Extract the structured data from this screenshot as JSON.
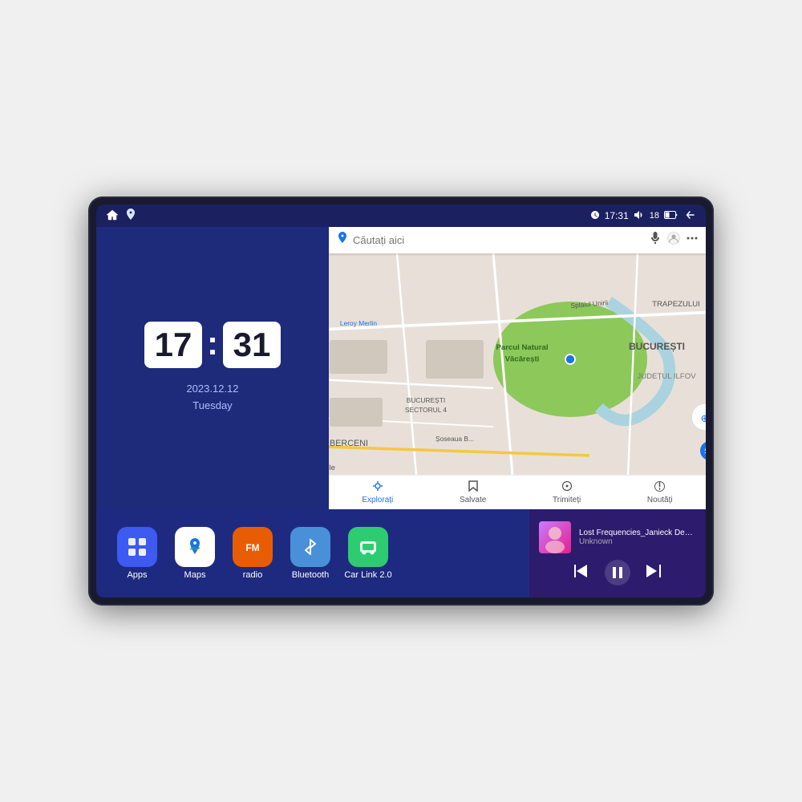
{
  "device": {
    "screen_bg": "#1a2060"
  },
  "status_bar": {
    "left_icons": [
      "home",
      "maps-pin"
    ],
    "time": "17:31",
    "battery": "18",
    "signal_icon": "wifi",
    "back_label": "↩"
  },
  "clock": {
    "hour": "17",
    "minute": "31",
    "date": "2023.12.12",
    "day": "Tuesday"
  },
  "map": {
    "search_placeholder": "Căutați aici",
    "location_label": "Parcul Natural Văcărești",
    "district_label": "BUCUREȘTI",
    "district2_label": "JUDEȚUL ILFOV",
    "area1": "BERCENI",
    "area2": "BUCUREȘTI SECTORUL 4",
    "area3": "TRAPEZULUI",
    "street1": "Splaiul Unirii",
    "street2": "Șoseaua B...",
    "bottom_nav": [
      {
        "label": "Explorați",
        "active": true
      },
      {
        "label": "Salvate",
        "active": false
      },
      {
        "label": "Trimiteți",
        "active": false
      },
      {
        "label": "Noutăți",
        "active": false
      }
    ]
  },
  "apps": [
    {
      "label": "Apps",
      "icon_type": "apps"
    },
    {
      "label": "Maps",
      "icon_type": "maps"
    },
    {
      "label": "radio",
      "icon_type": "radio"
    },
    {
      "label": "Bluetooth",
      "icon_type": "bluetooth"
    },
    {
      "label": "Car Link 2.0",
      "icon_type": "carlink"
    }
  ],
  "music": {
    "title": "Lost Frequencies_Janieck Devy-...",
    "artist": "Unknown",
    "controls": {
      "prev": "⏮",
      "play": "⏸",
      "next": "⏭"
    }
  }
}
